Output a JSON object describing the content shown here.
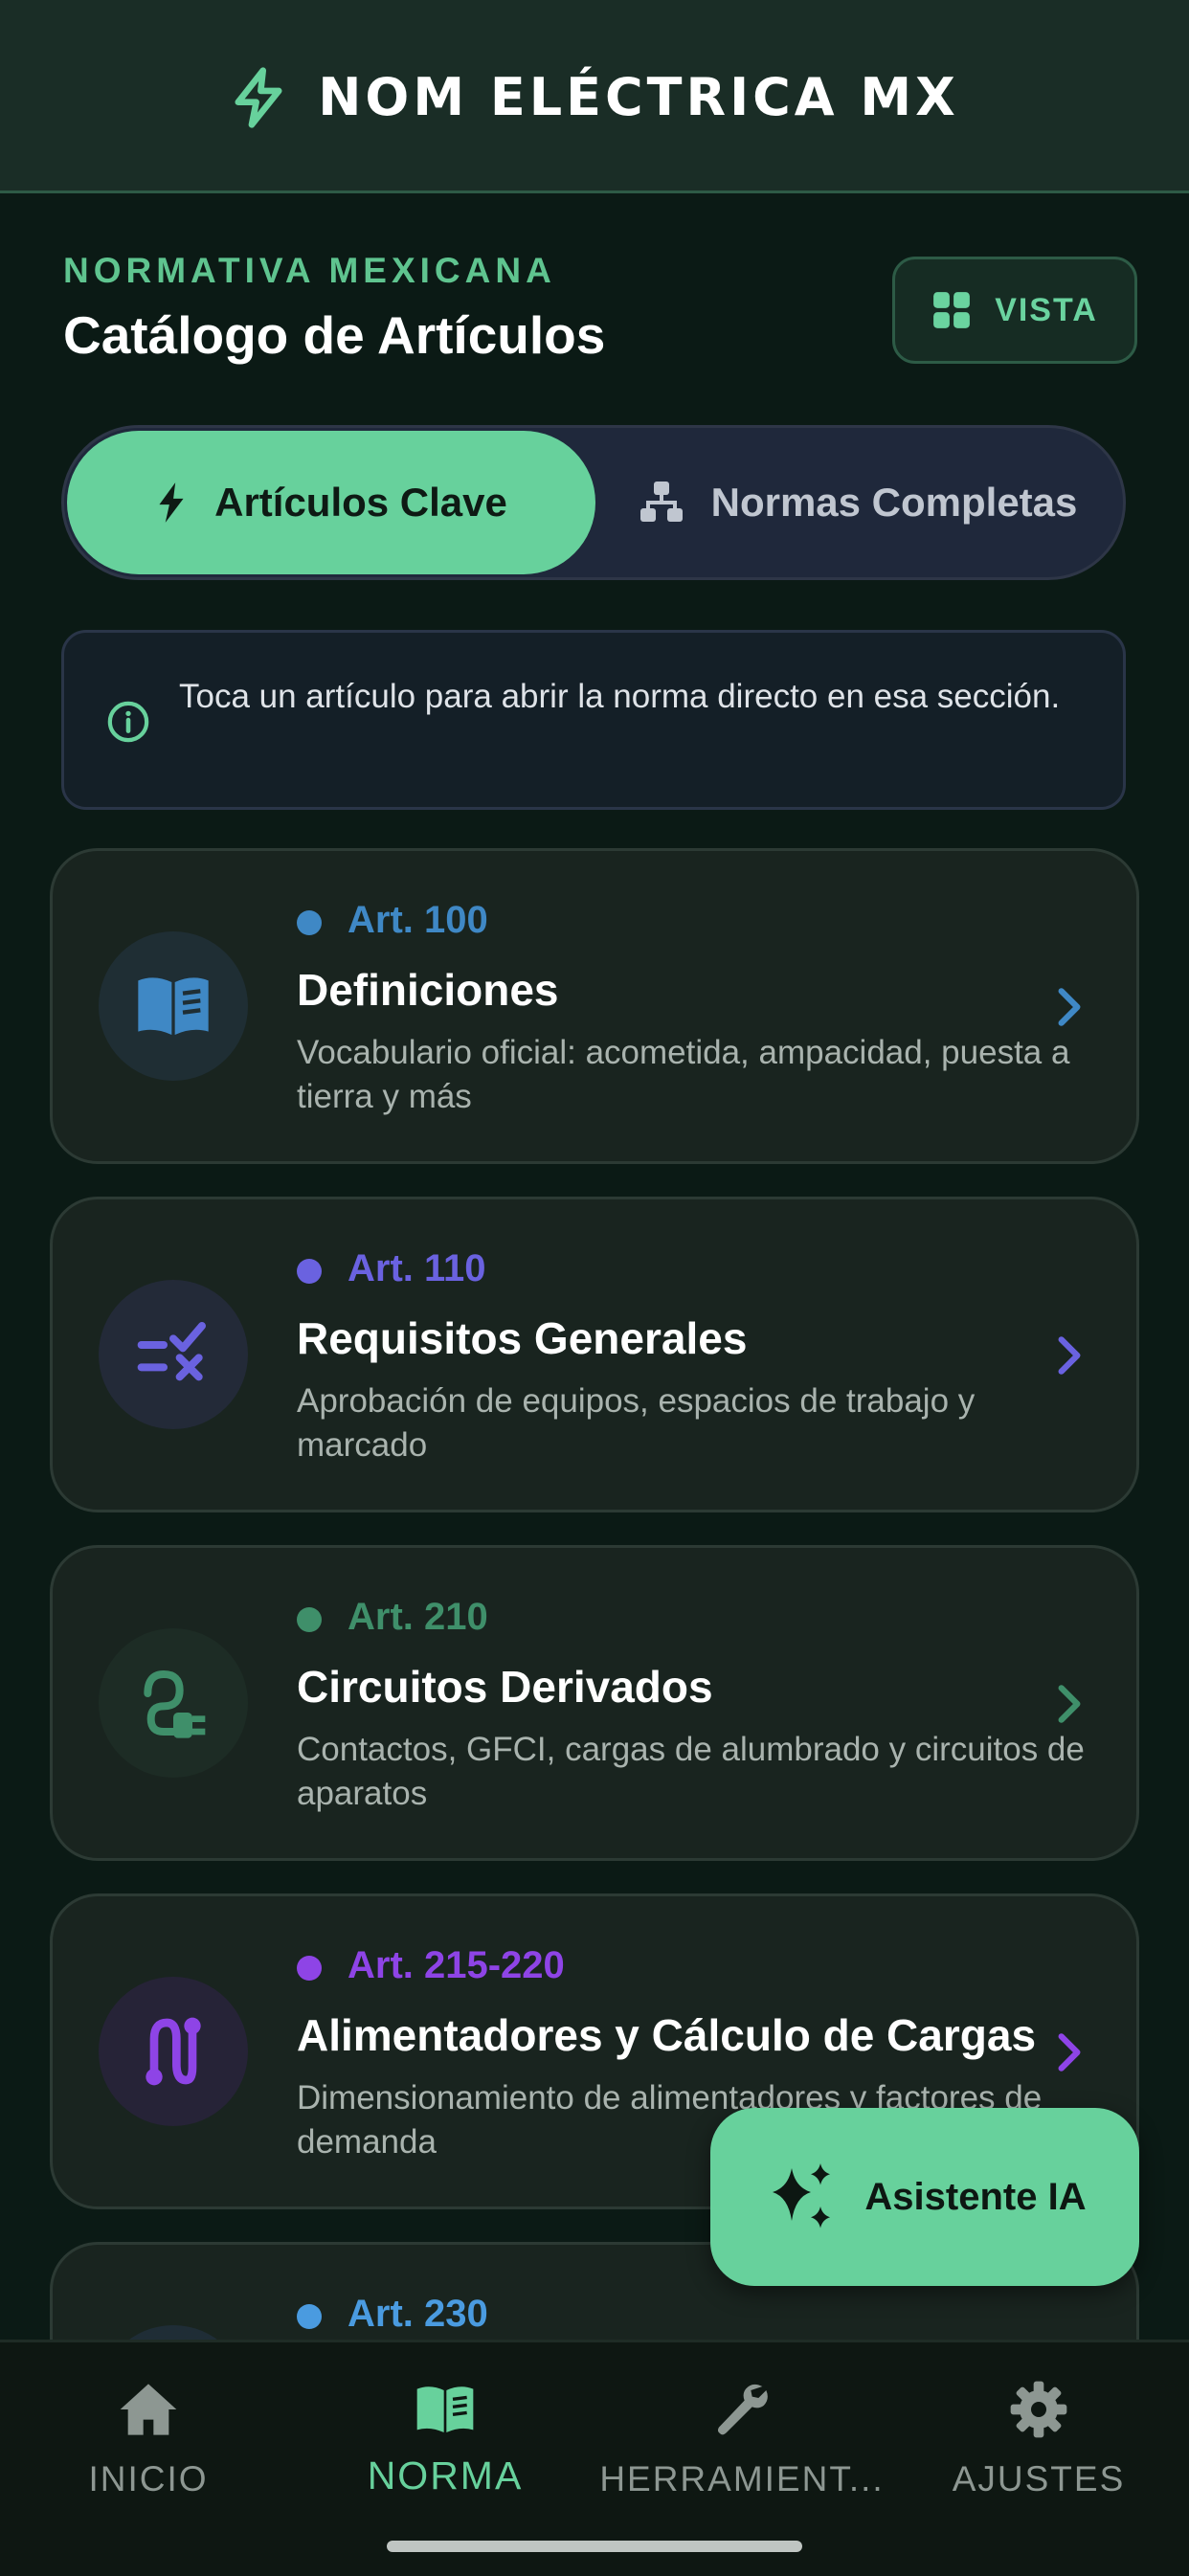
{
  "header": {
    "title": "NOM ELÉCTRICA MX",
    "icon": "bolt-icon",
    "accent": "#67d19c"
  },
  "intro": {
    "eyebrow": "NORMATIVA MEXICANA",
    "title": "Catálogo de Artículos"
  },
  "view_button": {
    "label": "VISTA",
    "icon": "grid-icon"
  },
  "segments": {
    "active": {
      "label": "Artículos Clave",
      "icon": "bolt-icon"
    },
    "inactive": {
      "label": "Normas Completas",
      "icon": "sitemap-icon"
    }
  },
  "info": {
    "text": "Toca un artículo para abrir la norma directo en esa sección.",
    "icon": "info-icon"
  },
  "cards": [
    {
      "art": "Art. 100",
      "title": "Definiciones",
      "desc": "Vocabulario oficial: acometida, ampacidad, puesta a tierra y más",
      "color": "#3f88c5",
      "icon": "book-icon"
    },
    {
      "art": "Art. 110",
      "title": "Requisitos Generales",
      "desc": "Aprobación de equipos, espacios de trabajo y marcado",
      "color": "#6a62e0",
      "icon": "checklist-icon"
    },
    {
      "art": "Art. 210",
      "title": "Circuitos Derivados",
      "desc": "Contactos, GFCI, cargas de alumbrado y circuitos de aparatos",
      "color": "#3f8f6a",
      "icon": "plug-icon"
    },
    {
      "art": "Art. 215-220",
      "title": "Alimentadores y Cálculo de Cargas",
      "desc": "Dimensionamiento de alimentadores y factores de demanda",
      "color": "#8e44e6",
      "icon": "route-icon"
    },
    {
      "art": "Art. 230",
      "title": "",
      "desc": "",
      "color": "#4a9be0",
      "icon": ""
    }
  ],
  "fab": {
    "label": "Asistente IA",
    "icon": "sparkles-icon"
  },
  "nav": [
    {
      "label": "INICIO",
      "icon": "home-icon",
      "active": false
    },
    {
      "label": "NORMA",
      "icon": "book-icon",
      "active": true
    },
    {
      "label": "HERRAMIENT...",
      "icon": "wrench-icon",
      "active": false
    },
    {
      "label": "AJUSTES",
      "icon": "gear-icon",
      "active": false
    }
  ]
}
